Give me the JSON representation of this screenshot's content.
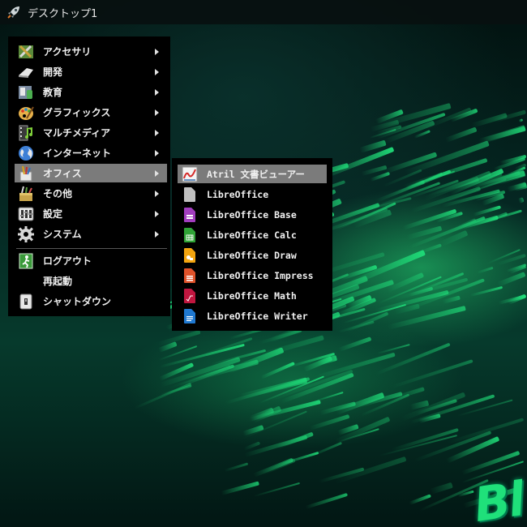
{
  "panel": {
    "launcher_icon": "rocket-icon",
    "title": "デスクトップ1"
  },
  "main_menu": {
    "items": [
      {
        "label": "アクセサリ",
        "icon": "accessories-icon",
        "submenu": true
      },
      {
        "label": "開発",
        "icon": "development-icon",
        "submenu": true
      },
      {
        "label": "教育",
        "icon": "education-icon",
        "submenu": true
      },
      {
        "label": "グラフィックス",
        "icon": "graphics-icon",
        "submenu": true
      },
      {
        "label": "マルチメディア",
        "icon": "multimedia-icon",
        "submenu": true
      },
      {
        "label": "インターネット",
        "icon": "internet-globe-icon",
        "submenu": true
      },
      {
        "label": "オフィス",
        "icon": "office-icon",
        "submenu": true,
        "active": true
      },
      {
        "label": "その他",
        "icon": "other-icon",
        "submenu": true
      },
      {
        "label": "設定",
        "icon": "settings-icon",
        "submenu": true
      },
      {
        "label": "システム",
        "icon": "system-gear-icon",
        "submenu": true
      }
    ],
    "session": [
      {
        "label": "ログアウト",
        "icon": "logout-icon"
      },
      {
        "label": "再起動",
        "icon": ""
      },
      {
        "label": "シャットダウン",
        "icon": "shutdown-icon"
      }
    ]
  },
  "office_submenu": {
    "items": [
      {
        "label": "Atril 文書ビューアー",
        "icon": "atril-icon",
        "color": "#d42a2a",
        "active": true
      },
      {
        "label": "LibreOffice",
        "icon": "libreoffice-icon",
        "color": "#bfbfbf"
      },
      {
        "label": "LibreOffice Base",
        "icon": "libreoffice-base-icon",
        "color": "#a23dbf"
      },
      {
        "label": "LibreOffice Calc",
        "icon": "libreoffice-calc-icon",
        "color": "#2fa336"
      },
      {
        "label": "LibreOffice Draw",
        "icon": "libreoffice-draw-icon",
        "color": "#f2a40f"
      },
      {
        "label": "LibreOffice Impress",
        "icon": "libreoffice-impress-icon",
        "color": "#e0522a"
      },
      {
        "label": "LibreOffice Math",
        "icon": "libreoffice-math-icon",
        "color": "#c0163f"
      },
      {
        "label": "LibreOffice Writer",
        "icon": "libreoffice-writer-icon",
        "color": "#1f78d1"
      }
    ]
  },
  "wallpaper": {
    "brand_text": "Bl",
    "accent": "#1fe07a"
  }
}
